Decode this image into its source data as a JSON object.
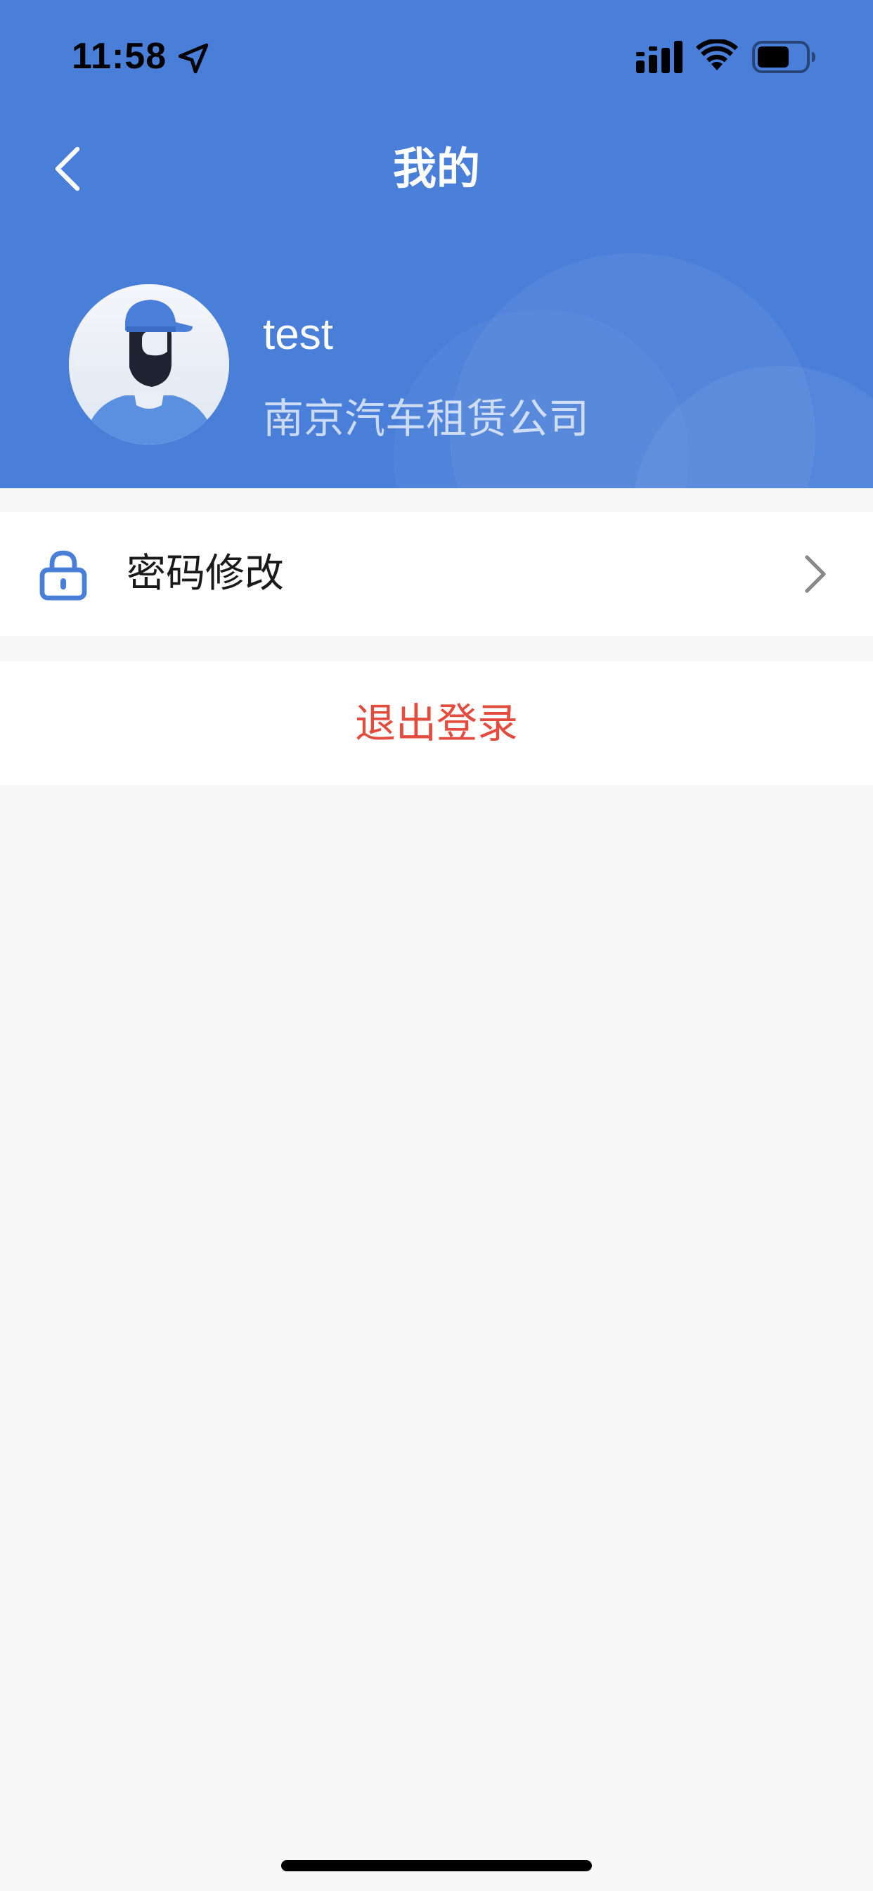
{
  "status_bar": {
    "time": "11:58",
    "icons": [
      "location-arrow-icon",
      "signal-icon",
      "wifi-icon",
      "battery-icon"
    ]
  },
  "nav": {
    "title": "我的",
    "back_icon": "chevron-left-icon"
  },
  "profile": {
    "name": "test",
    "company": "南京汽车租赁公司",
    "avatar_icon": "user-avatar-icon"
  },
  "menu": {
    "items": [
      {
        "label": "密码修改",
        "icon": "lock-icon",
        "trailing_icon": "chevron-right-icon"
      }
    ]
  },
  "logout": {
    "label": "退出登录"
  },
  "colors": {
    "header_bg": "#4a7fd9",
    "page_bg": "#f7f7f7",
    "logout_text": "#e34b3c",
    "icon_blue": "#4a7fd9"
  }
}
